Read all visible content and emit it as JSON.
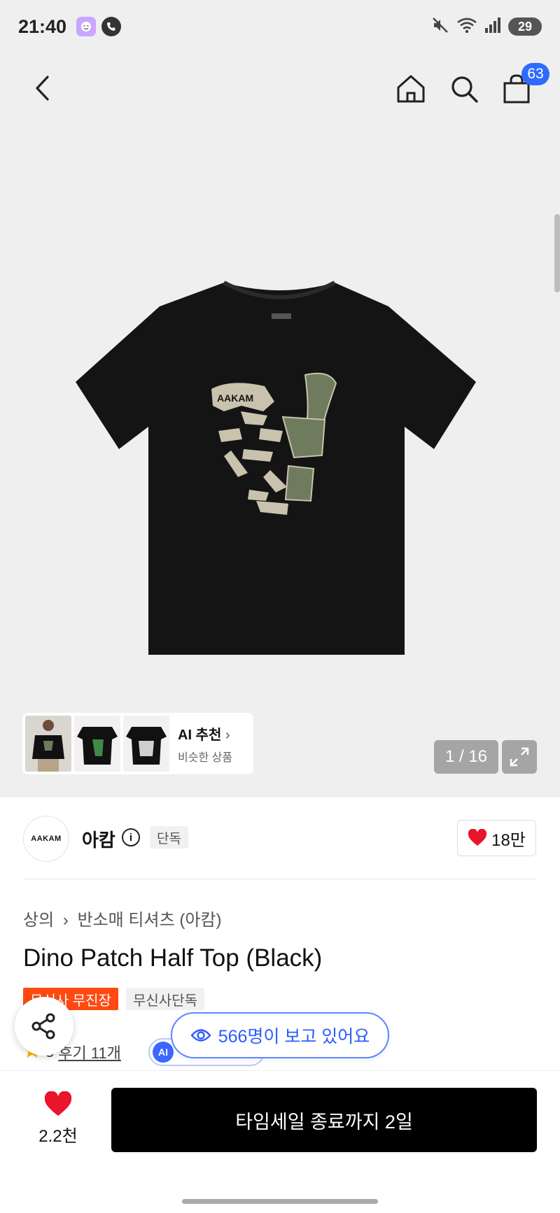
{
  "status_bar": {
    "time": "21:40",
    "battery": "29"
  },
  "header": {
    "cart_count": "63"
  },
  "hero": {
    "ai_card": {
      "title": "AI 추천",
      "subtitle": "비슷한 상품"
    },
    "image_counter": "1 / 16"
  },
  "brand": {
    "logo_text": "AAKAM",
    "name": "아캄",
    "exclusive_tag": "단독",
    "likes": "18만"
  },
  "product": {
    "breadcrumb": [
      "상의",
      "반소매 티셔츠 (아캄)"
    ],
    "title": "Dino Patch Half Top (Black)",
    "badges": [
      "무신사 무진장",
      "무신사단독"
    ],
    "rating": "5",
    "review_link": "후기 11개",
    "ai_chip_label": "AI"
  },
  "viewers_pill": "566명이 보고 있어요",
  "bottom_bar": {
    "wish_count": "2.2천",
    "buy_label": "타임세일 종료까지 2일"
  },
  "colors": {
    "accent_blue": "#2f6bff",
    "badge_orange": "#ff4a12",
    "heart_red": "#e8152b"
  }
}
